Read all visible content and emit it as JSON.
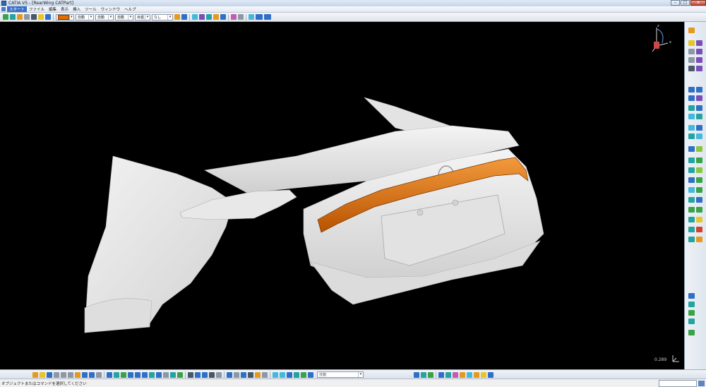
{
  "window": {
    "title": "CATIA V5 - [RearWing CATPart]",
    "buttons": {
      "minimize": "–",
      "maximize": "□",
      "close": "x"
    }
  },
  "menu": {
    "items": [
      "スタート",
      "ファイル",
      "編集",
      "表示",
      "挿入",
      "ツール",
      "ウィンドウ",
      "ヘルプ"
    ]
  },
  "toolbar": {
    "color_swatch": "#e46b00",
    "combo_1": "自動",
    "combo_2": "自動",
    "combo_3": "自動",
    "combo_4": "目盛",
    "combo_5": "なし"
  },
  "viewport": {
    "background": "#000000",
    "scale_value": "0.289",
    "compass_labels": {
      "z": "z",
      "x": "x",
      "y": "y"
    },
    "highlight_color": "#e46b00"
  },
  "bottom_toolbar": {
    "combo_value": "分割"
  },
  "status": {
    "text": "オブジェクトまたはコマンドを選択してください"
  }
}
